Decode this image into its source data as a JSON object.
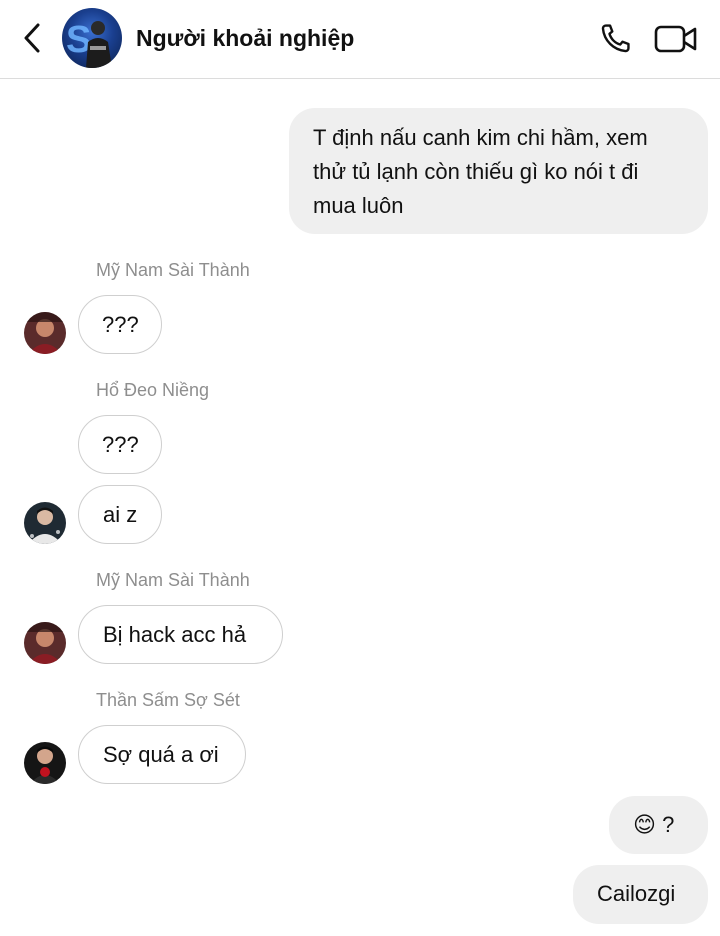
{
  "header": {
    "title": "Người khoải nghiệp",
    "back_icon": "chevron-left-icon",
    "call_icon": "phone-icon",
    "video_icon": "video-camera-icon"
  },
  "messages": [
    {
      "direction": "outgoing",
      "lines": [
        "T định nấu canh kim chi hầm, xem",
        "thử tủ lạnh còn thiếu gì ko nói t đi",
        "mua luôn"
      ]
    },
    {
      "direction": "incoming",
      "sender": "Mỹ Nam Sài Thành",
      "text": "???"
    },
    {
      "direction": "incoming",
      "sender": "Hổ Đeo Niềng",
      "text": "???"
    },
    {
      "direction": "incoming",
      "text": "ai z"
    },
    {
      "direction": "incoming",
      "sender": "Mỹ Nam Sài Thành",
      "text": "Bị hack acc hả"
    },
    {
      "direction": "incoming",
      "sender": "Thần Sấm Sợ Sét",
      "text": "Sợ quá a ơi"
    },
    {
      "direction": "outgoing",
      "emoji": "😊",
      "text": "?"
    },
    {
      "direction": "outgoing",
      "text": "Cailozgi"
    }
  ],
  "colors": {
    "outgoing_bubble": "#efefef",
    "incoming_border": "#cfcfcf",
    "sender_name": "#8e8e8e"
  }
}
